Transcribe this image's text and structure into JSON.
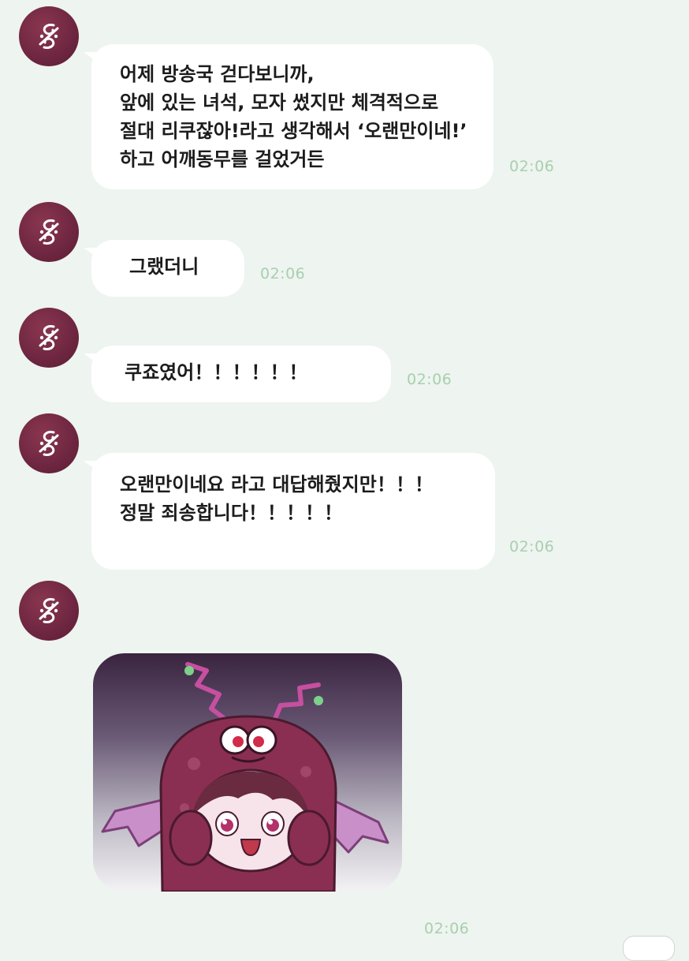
{
  "messages": [
    {
      "lines": [
        "어제 방송국 걷다보니까,",
        "앞에 있는 녀석, 모자 썼지만 체격적으로",
        "절대 리쿠잖아!라고 생각해서 ‘오랜만이네!’",
        "하고 어깨동무를 걸었거든"
      ],
      "time": "02:06"
    },
    {
      "lines": [
        "그랬더니"
      ],
      "time": "02:06"
    },
    {
      "lines": [
        "쿠죠였어！！！！！！"
      ],
      "time": "02:06"
    },
    {
      "lines": [
        "오랜만이네요 라고 대답해줬지만！！！",
        "정말 죄송합니다！！！！！"
      ],
      "time": "02:06"
    },
    {
      "sticker": "dark-red-hooded-monster-character-sticker",
      "time": "02:06"
    }
  ],
  "avatar_icon": "music-note-logo-icon",
  "colors": {
    "background": "#eef4ef",
    "bubble": "#ffffff",
    "avatar": "#6e2640",
    "timestamp": "#a8cfb0"
  }
}
